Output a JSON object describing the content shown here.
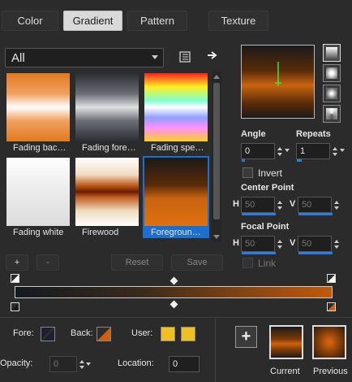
{
  "tabs": [
    {
      "label": "Color"
    },
    {
      "label": "Gradient"
    },
    {
      "label": "Pattern"
    },
    {
      "label": "Texture"
    }
  ],
  "active_tab": "Gradient",
  "category_dropdown": {
    "value": "All"
  },
  "gallery": {
    "items": [
      {
        "label": "Fading bac…"
      },
      {
        "label": "Fading fore…"
      },
      {
        "label": "Fading spe…"
      },
      {
        "label": "Fading white"
      },
      {
        "label": "Firewood"
      },
      {
        "label": "Foregroun…"
      }
    ],
    "selected_index": 5
  },
  "angle": {
    "label": "Angle",
    "value": "0"
  },
  "repeats": {
    "label": "Repeats",
    "value": "1"
  },
  "invert": {
    "label": "Invert",
    "checked": false
  },
  "center_point": {
    "label": "Center Point",
    "h_label": "H",
    "h_value": "50",
    "v_label": "V",
    "v_value": "50"
  },
  "focal_point": {
    "label": "Focal Point",
    "h_label": "H",
    "h_value": "50",
    "v_label": "V",
    "v_value": "50"
  },
  "link": {
    "label": "Link",
    "checked": false
  },
  "editor_buttons": {
    "add": "+",
    "remove": "-",
    "reset": "Reset",
    "save": "Save"
  },
  "bottom": {
    "fore_label": "Fore:",
    "back_label": "Back:",
    "user_label": "User:",
    "opacity_label": "Opacity:",
    "opacity_value": "0",
    "location_label": "Location:",
    "location_value": "0",
    "add_label": "+",
    "current_label": "Current",
    "previous_label": "Previous"
  },
  "colors": {
    "user_color": "#f0c020",
    "accent": "#1d6fcf",
    "gradient_start": "#141a22",
    "gradient_end": "#c05a0a"
  }
}
